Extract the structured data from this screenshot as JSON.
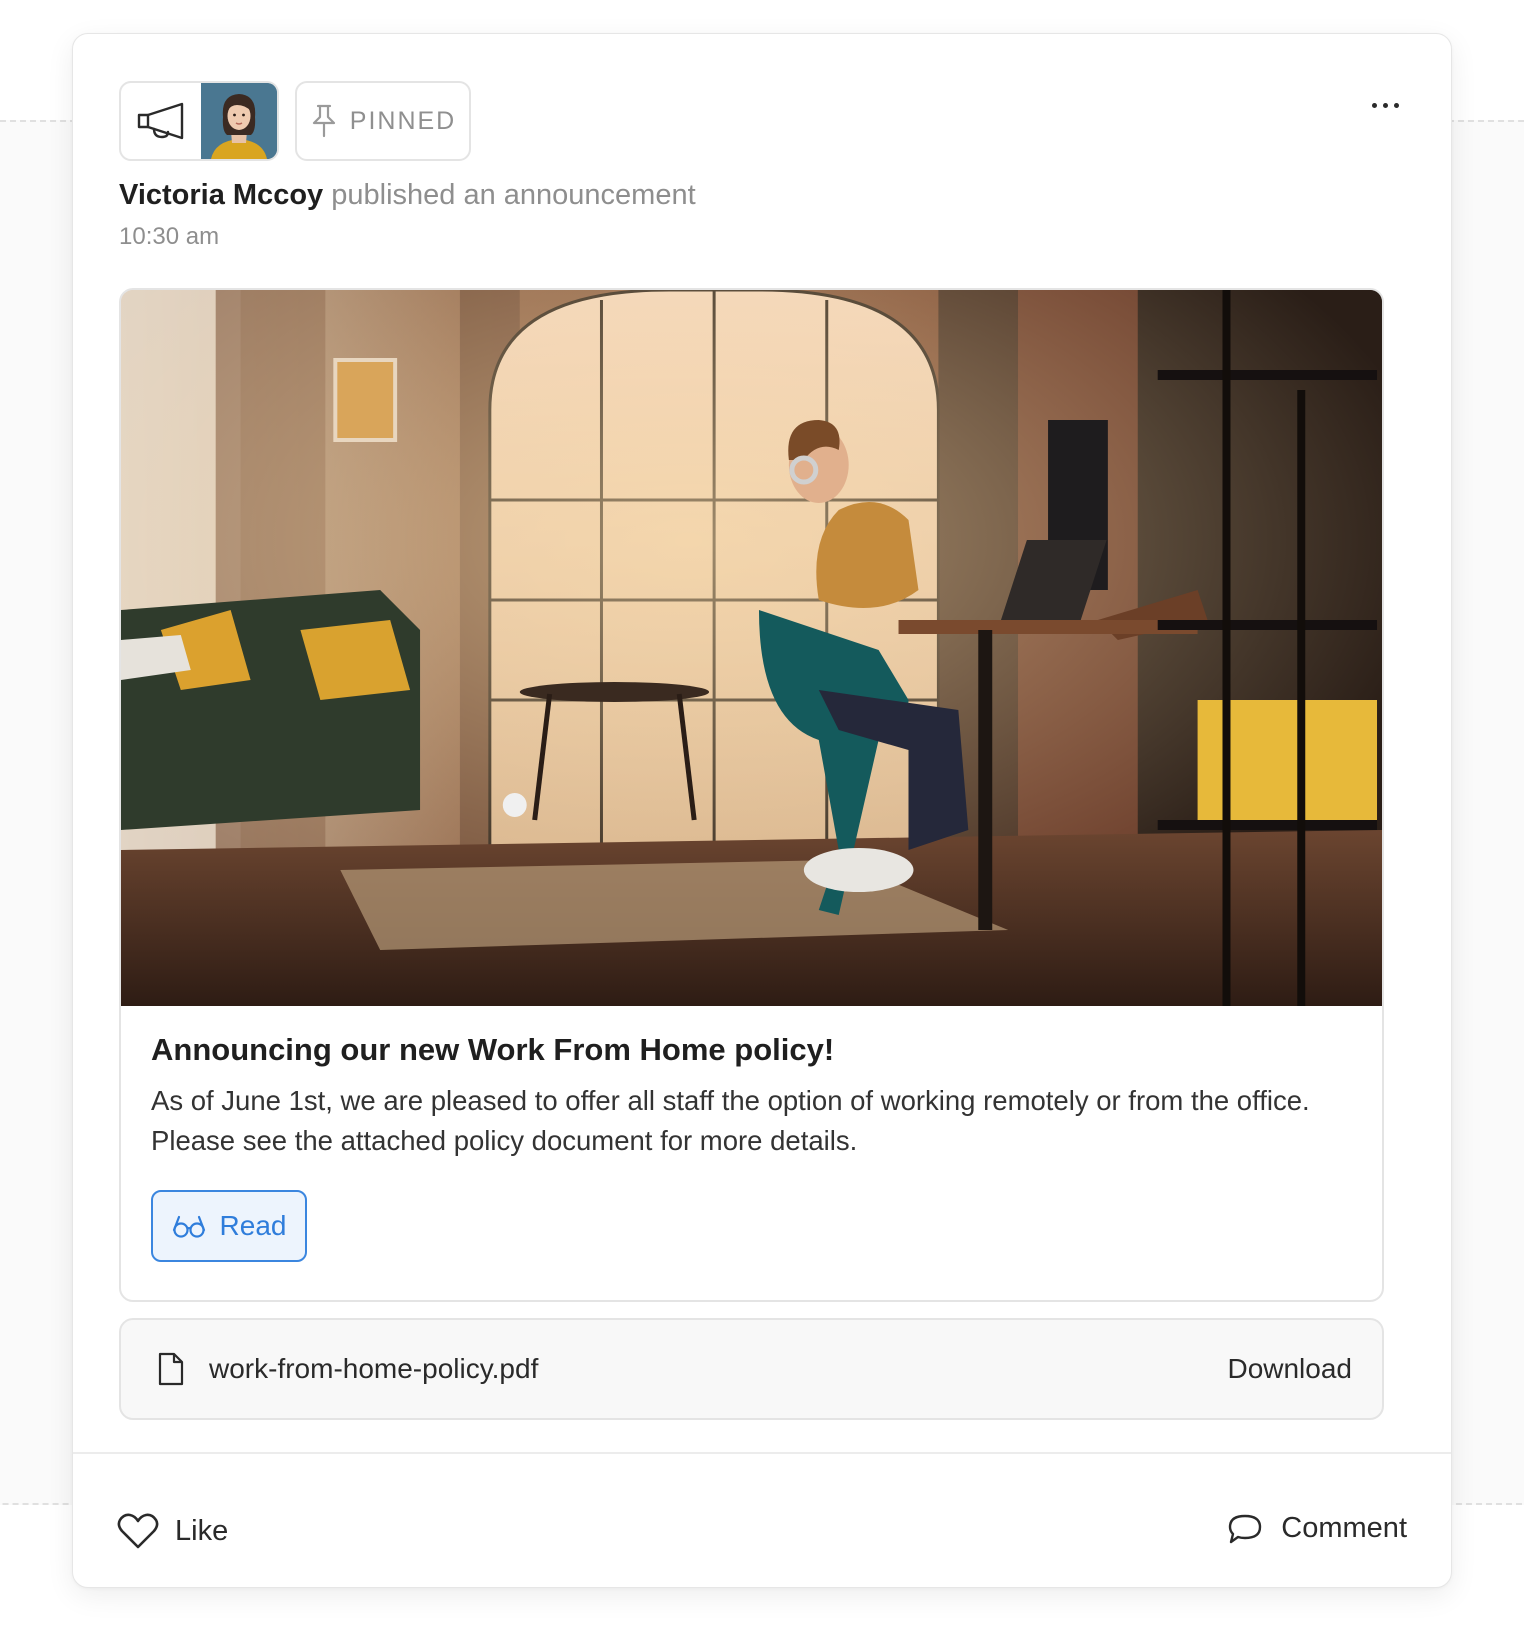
{
  "post": {
    "pinned_label": "PINNED",
    "author": "Victoria Mccoy",
    "action_text": "published an announcement",
    "time": "10:30 am",
    "title": "Announcing our new Work From Home policy!",
    "body": "As of June 1st, we are pleased to offer all staff the option of working remotely or from the office. Please see the attached policy document for more details.",
    "read_label": "Read"
  },
  "attachment": {
    "file_name": "work-from-home-policy.pdf",
    "download_label": "Download"
  },
  "footer": {
    "like_label": "Like",
    "comment_label": "Comment"
  },
  "icons": {
    "announcement": "megaphone-icon",
    "pin": "pin-icon",
    "more": "more-horizontal-icon",
    "read": "glasses-icon",
    "file": "file-icon",
    "like": "heart-icon",
    "comment": "comment-bubble-icon"
  },
  "colors": {
    "accent": "#2f7ddb",
    "accent_bg": "#edf4fd",
    "muted_text": "#8e8e8e",
    "border": "#e4e4e4"
  }
}
